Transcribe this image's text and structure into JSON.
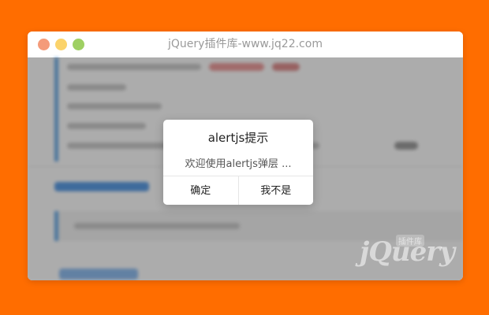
{
  "window": {
    "title": "jQuery插件库-www.jq22.com"
  },
  "dialog": {
    "title": "alertjs提示",
    "message": "欢迎使用alertjs弹层 ...",
    "confirm_label": "确定",
    "cancel_label": "我不是"
  },
  "watermark": {
    "brand": "jQuery",
    "tag": "插件库"
  },
  "colors": {
    "background": "#ff6d00",
    "accent": "#69a7e0",
    "overlay": "rgba(0,0,0,0.3)"
  }
}
